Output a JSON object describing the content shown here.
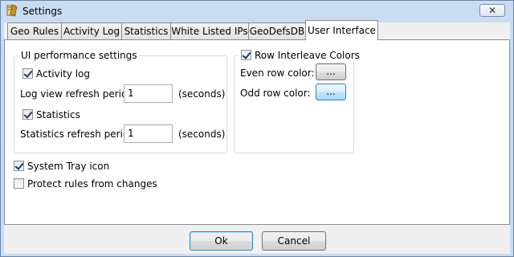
{
  "window": {
    "title": "Settings",
    "close_label": "✕"
  },
  "tabs": [
    {
      "label": "Geo Rules",
      "active": false
    },
    {
      "label": "Activity Log",
      "active": false
    },
    {
      "label": "Statistics",
      "active": false
    },
    {
      "label": "White Listed IPs",
      "active": false
    },
    {
      "label": "GeoDefsDB",
      "active": false
    },
    {
      "label": "User Interface",
      "active": true
    }
  ],
  "ui_performance": {
    "group_title": "UI performance settings",
    "activity_log": {
      "label": "Activity log",
      "checked": true
    },
    "log_refresh": {
      "label": "Log view refresh period",
      "value": "1",
      "unit": "(seconds)"
    },
    "statistics": {
      "label": "Statistics",
      "checked": true
    },
    "stats_refresh": {
      "label": "Statistics refresh period",
      "value": "1",
      "unit": "(seconds)"
    }
  },
  "row_colors": {
    "group_title": "Row Interleave Colors",
    "checked": true,
    "even_label": "Even row color:",
    "even_button": "...",
    "odd_label": "Odd row color:",
    "odd_button": "..."
  },
  "system_tray": {
    "label": "System Tray icon",
    "checked": true
  },
  "protect_rules": {
    "label": "Protect rules from changes",
    "checked": false
  },
  "footer": {
    "ok_label": "Ok",
    "cancel_label": "Cancel"
  }
}
